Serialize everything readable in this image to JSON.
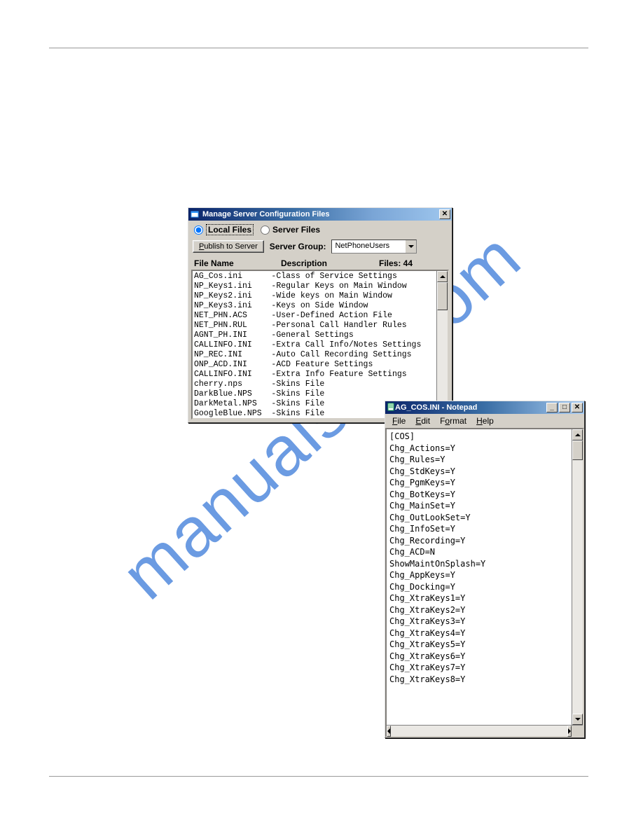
{
  "watermark": "manualslib.com",
  "win1": {
    "title": "Manage Server Configuration Files",
    "radio_local": "Local Files",
    "radio_server": "Server Files",
    "publish_btn_prefix": "P",
    "publish_btn_rest": "ublish to Server",
    "server_group_label": "Server Group:",
    "server_group_value": "NetPhoneUsers",
    "header_filename": "File Name",
    "header_description": "Description",
    "header_files": "Files: 44",
    "rows": [
      {
        "name": "AG_Cos.ini",
        "desc": "-Class of Service Settings"
      },
      {
        "name": "NP_Keys1.ini",
        "desc": "-Regular Keys on Main Window"
      },
      {
        "name": "NP_Keys2.ini",
        "desc": "-Wide keys on Main Window"
      },
      {
        "name": "NP_Keys3.ini",
        "desc": "-Keys on Side Window"
      },
      {
        "name": "NET_PHN.ACS",
        "desc": "-User-Defined Action File"
      },
      {
        "name": "NET_PHN.RUL",
        "desc": "-Personal Call Handler Rules"
      },
      {
        "name": "AGNT_PH.INI",
        "desc": "-General Settings"
      },
      {
        "name": "CALLINFO.INI",
        "desc": "-Extra Call Info/Notes Settings"
      },
      {
        "name": "NP_REC.INI",
        "desc": "-Auto Call Recording Settings"
      },
      {
        "name": "ONP_ACD.INI",
        "desc": "-ACD Feature Settings"
      },
      {
        "name": "CALLINFO.INI",
        "desc": "-Extra Info Feature Settings"
      },
      {
        "name": "cherry.nps",
        "desc": "-Skins File"
      },
      {
        "name": "DarkBlue.NPS",
        "desc": "-Skins File"
      },
      {
        "name": "DarkMetal.NPS",
        "desc": "-Skins File"
      },
      {
        "name": "GoogleBlue.NPS",
        "desc": "-Skins File"
      }
    ]
  },
  "win2": {
    "title": "AG_COS.INI - Notepad",
    "menu": {
      "file": "File",
      "edit": "Edit",
      "format": "Format",
      "help": "Help"
    },
    "content": "[COS]\nChg_Actions=Y\nChg_Rules=Y\nChg_StdKeys=Y\nChg_PgmKeys=Y\nChg_BotKeys=Y\nChg_MainSet=Y\nChg_OutLookSet=Y\nChg_InfoSet=Y\nChg_Recording=Y\nChg_ACD=N\nShowMaintOnSplash=Y\nChg_AppKeys=Y\nChg_Docking=Y\nChg_XtraKeys1=Y\nChg_XtraKeys2=Y\nChg_XtraKeys3=Y\nChg_XtraKeys4=Y\nChg_XtraKeys5=Y\nChg_XtraKeys6=Y\nChg_XtraKeys7=Y\nChg_XtraKeys8=Y"
  }
}
